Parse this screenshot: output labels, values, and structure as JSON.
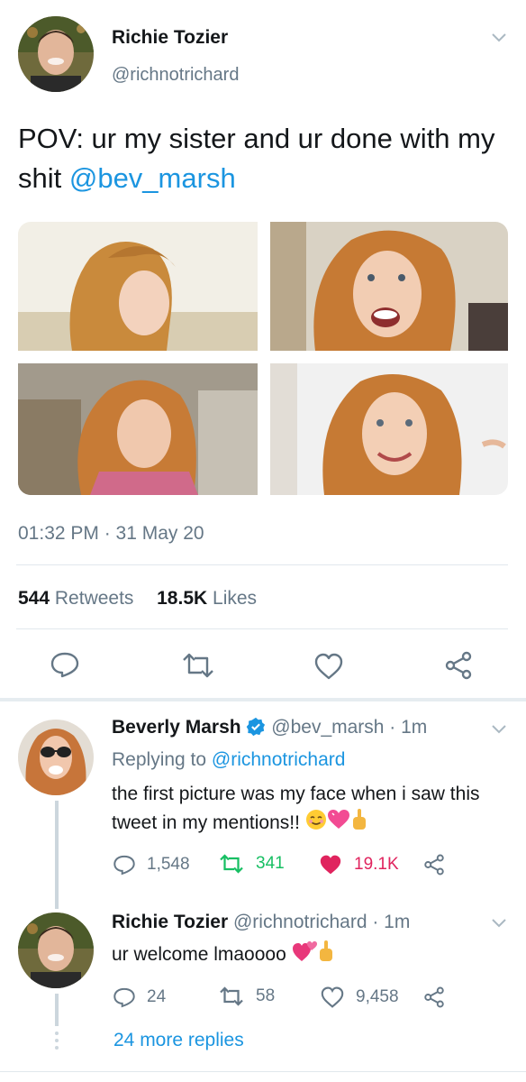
{
  "tweet": {
    "author_name": "Richie Tozier",
    "author_handle": "@richnotrichard",
    "text_plain": "POV: ur my sister and ur done with my shit ",
    "mention": "@bev_marsh",
    "timestamp": "01:32 PM · 31 May 20",
    "retweets_count": "544",
    "retweets_label": "Retweets",
    "likes_count": "18.5K",
    "likes_label": "Likes",
    "actions": [
      "reply-icon",
      "retweet-icon",
      "like-icon",
      "share-icon"
    ]
  },
  "reply1": {
    "author_name": "Beverly Marsh",
    "verified": true,
    "handle_time": "@bev_marsh · 1m",
    "replying_prefix": "Replying to ",
    "replying_to": "@richnotrichard",
    "text": "the first picture was my face when i saw this tweet in my mentions!!",
    "emojis": [
      "smiling-face-emoji",
      "pink-heart-emoji",
      "middle-finger-emoji"
    ],
    "reply_count": "1,548",
    "retweet_count": "341",
    "like_count": "19.1K",
    "liked": true,
    "retweeted_color": "#17bf63",
    "liked_color": "#e0245e"
  },
  "reply2": {
    "author_name": "Richie Tozier",
    "handle_time": "@richnotrichard · 1m",
    "text": "ur welcome lmaoooo",
    "emojis": [
      "revolving-hearts-emoji",
      "middle-finger-emoji"
    ],
    "reply_count": "24",
    "retweet_count": "58",
    "like_count": "9,458"
  },
  "more_replies": "24 more replies",
  "colors": {
    "accent": "#1b95e0",
    "gray": "#657786",
    "divider": "#e1e8ed"
  }
}
